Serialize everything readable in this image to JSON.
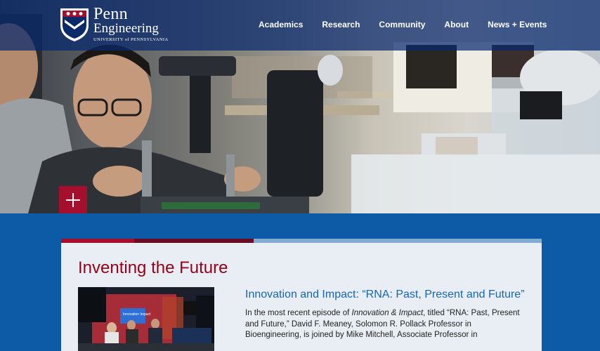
{
  "header": {
    "logo": {
      "line1": "Penn",
      "line2": "Engineering",
      "line3": "UNIVERSITY of PENNSYLVANIA"
    },
    "nav": [
      {
        "label": "Academics"
      },
      {
        "label": "Research"
      },
      {
        "label": "Community"
      },
      {
        "label": "About"
      },
      {
        "label": "News + Events"
      }
    ]
  },
  "hero": {
    "expand_icon": "plus-icon"
  },
  "card": {
    "title": "Inventing the Future",
    "video_overlay_text": "Innovation Impact",
    "headline": "Innovation and Impact: “RNA: Past, Present and Future”",
    "body_before_italic": "In the most recent episode of ",
    "body_italic": "Innovation & Impact",
    "body_after_italic": ", titled “RNA: Past, Present and Future,” David F. Meaney, Solomon R. Pollack Professor in Bioengineering, is joined by Mike Mitchell, Associate Professor in"
  },
  "colors": {
    "header_bg": "#07286e",
    "accent_red": "#a50f2d",
    "page_blue": "#0d5aa7",
    "title_red": "#95001a",
    "headline_blue": "#1866b0"
  }
}
